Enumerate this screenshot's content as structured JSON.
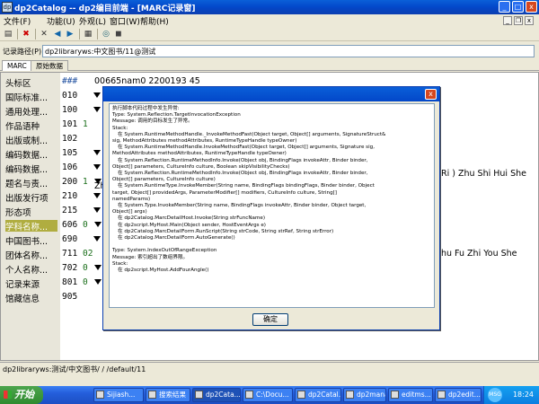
{
  "window": {
    "title": "dp2Catalog -- dp2编目前端 - [MARC记录窗]",
    "controls": {
      "minimize": "_",
      "maximize": "□",
      "close": "x"
    }
  },
  "menubar": {
    "items": [
      "文件(F)",
      "功能(U)",
      "外观(L)",
      "窗口(W)",
      "帮助(H)"
    ],
    "mdi_controls": {
      "minimize": "_",
      "restore": "❐",
      "close": "x"
    }
  },
  "toolbar": {
    "icons": [
      "save-icon",
      "delete-icon",
      "close-icon",
      "prev-icon",
      "next-icon",
      "view-icon",
      "search-icon",
      "stop-icon"
    ]
  },
  "path_row": {
    "label": "记录路径(P):",
    "value": "dp2libraryws:中文图书/11@测试"
  },
  "tabs": [
    "MARC",
    "原始数据"
  ],
  "marc_fields": [
    {
      "name": "头标区",
      "tag": "###",
      "ind": "",
      "value": "00665nam0 2200193  45"
    },
    {
      "name": "国际标准...",
      "tag": "010",
      "ind": "",
      "value": ""
    },
    {
      "name": "通用处理...",
      "tag": "100",
      "ind": "",
      "value": ""
    },
    {
      "name": "作品语种",
      "tag": "101",
      "ind": "1",
      "value": ""
    },
    {
      "name": "出版或制...",
      "tag": "102",
      "ind": "",
      "value": ""
    },
    {
      "name": "编码数据...",
      "tag": "105",
      "ind": "",
      "value": ""
    },
    {
      "name": "编码数据...",
      "tag": "106",
      "ind": "",
      "value": ""
    },
    {
      "name": "题名与责...",
      "tag": "200",
      "ind": "1",
      "value": ""
    },
    {
      "name": "出版发行项",
      "tag": "210",
      "ind": "",
      "value": ""
    },
    {
      "name": "形态项",
      "tag": "215",
      "ind": "",
      "value": ""
    },
    {
      "name": "学科名称...",
      "tag": "606",
      "ind": "0",
      "value": ""
    },
    {
      "name": "中国图书...",
      "tag": "690",
      "ind": "",
      "value": ""
    },
    {
      "name": "团体名称...",
      "tag": "711",
      "ind": "02",
      "value": ""
    },
    {
      "name": "个人名称...",
      "tag": "702",
      "ind": "0",
      "value": ""
    },
    {
      "name": "记录来源",
      "tag": "801",
      "ind": "0",
      "value": ""
    },
    {
      "name": "馆藏信息",
      "tag": "905",
      "ind": "",
      "value": ""
    }
  ],
  "overflow_text": {
    "row200": "Ri ) Zhu Shi Hui She",
    "row200b": "Zh",
    "row711": "hu Fu Zhi You She"
  },
  "dialog": {
    "close": "x",
    "lines": [
      "执行脚本代码过程中发生异常:",
      "Type: System.Reflection.TargetInvocationException",
      "Message: 调用的目标发生了异常。",
      "Stack:",
      "在 System.RuntimeMethodHandle._InvokeMethodFast(Object target, Object[] arguments, SignatureStruct&",
      "sig, MethodAttributes methodAttributes, RuntimeTypeHandle typeOwner)",
      "在 System.RuntimeMethodHandle.InvokeMethodFast(Object target, Object[] arguments, Signature sig,",
      "MethodAttributes methodAttributes, RuntimeTypeHandle typeOwner)",
      "在 System.Reflection.RuntimeMethodInfo.Invoke(Object obj, BindingFlags invokeAttr, Binder binder,",
      "Object[] parameters, CultureInfo culture, Boolean skipVisibilityChecks)",
      "在 System.Reflection.RuntimeMethodInfo.Invoke(Object obj, BindingFlags invokeAttr, Binder binder,",
      "Object[] parameters, CultureInfo culture)",
      "在 System.RuntimeType.InvokeMember(String name, BindingFlags bindingFlags, Binder binder, Object",
      "target, Object[] providedArgs, ParameterModifier[] modifiers, CultureInfo culture, String[]",
      "namedParams)",
      "在 System.Type.InvokeMember(String name, BindingFlags invokeAttr, Binder binder, Object target,",
      "Object[] args)",
      "在 dp2Catalog.MarcDetailHost.Invoke(String strFuncName)",
      "在 dp2script.MyHost.Main(Object sender, HostEventArgs e)",
      "在 dp2Catalog.MarcDetailForm.RunScript(String strCode, String strRef, String strError)",
      "在 dp2Catalog.MarcDetailForm.AutoGenerate()",
      "",
      "Type: System.IndexOutOfRangeException",
      "Message: 索引超出了数组界限。",
      "Stack:",
      "在 dp2script.MyHost.AddFourAngle()"
    ],
    "ok_label": "确定"
  },
  "statusbar": {
    "text": "dp2libraryws:测试/中文图书/ / /default/11"
  },
  "taskbar": {
    "start_label": "开始",
    "tasks": [
      "Sijiash...",
      "搜索结果",
      "dp2Cata...",
      "C:\\Docu...",
      "dp2Catal...",
      "dp2mana...",
      "editms...",
      "dp2edit..."
    ],
    "active_index": 2,
    "tray_badge": "MSG",
    "clock": "18:24"
  }
}
